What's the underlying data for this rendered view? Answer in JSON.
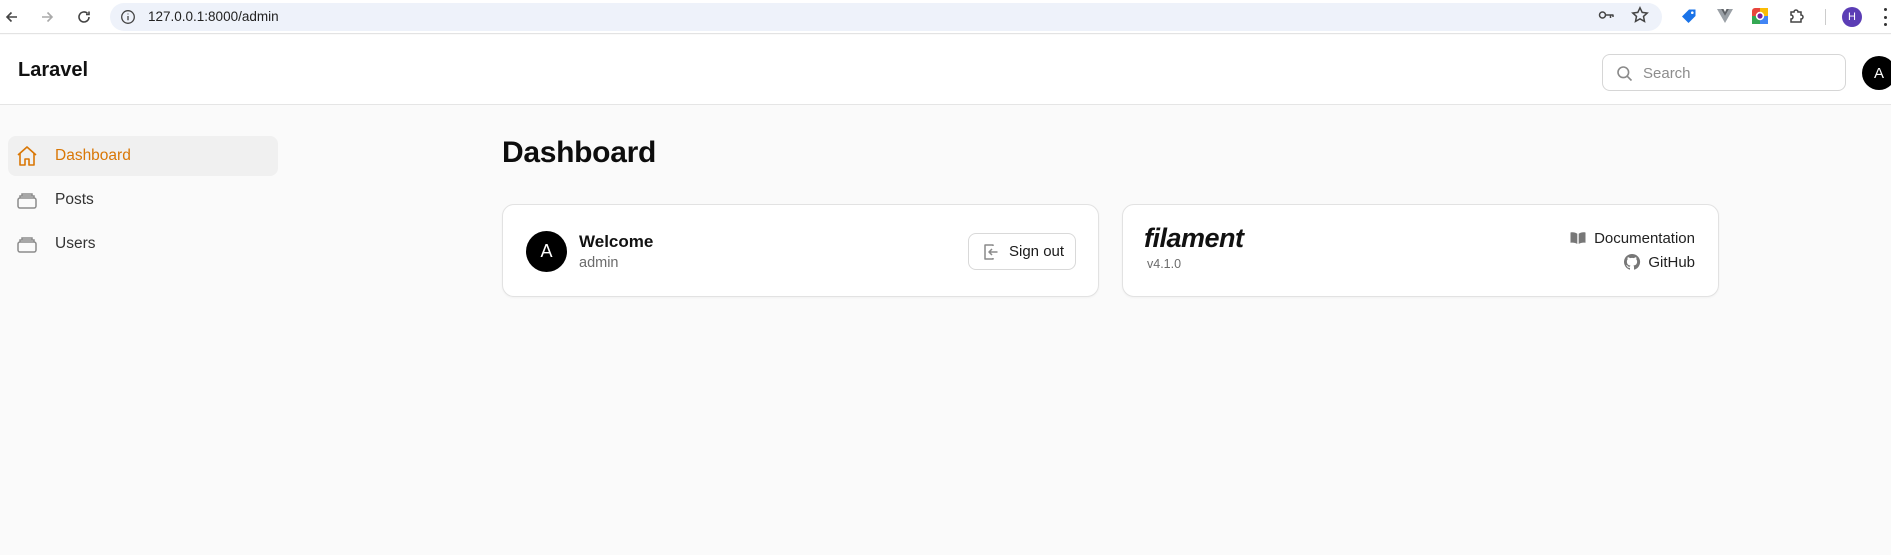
{
  "browser": {
    "url": "127.0.0.1:8000/admin",
    "profile_initial": "H"
  },
  "app": {
    "brand": "Laravel",
    "search_placeholder": "Search",
    "user_initial": "A"
  },
  "sidebar": {
    "items": [
      {
        "label": "Dashboard",
        "icon": "home-icon",
        "active": true
      },
      {
        "label": "Posts",
        "icon": "collection-icon",
        "active": false
      },
      {
        "label": "Users",
        "icon": "collection-icon",
        "active": false
      }
    ]
  },
  "main": {
    "title": "Dashboard",
    "welcome": {
      "avatar_initial": "A",
      "title": "Welcome",
      "subtitle": "admin",
      "signout_label": "Sign out"
    },
    "filament": {
      "logo": "filament",
      "version": "v4.1.0",
      "documentation_label": "Documentation",
      "github_label": "GitHub"
    }
  },
  "colors": {
    "accent": "#d97706",
    "page_bg": "#fafafa"
  }
}
